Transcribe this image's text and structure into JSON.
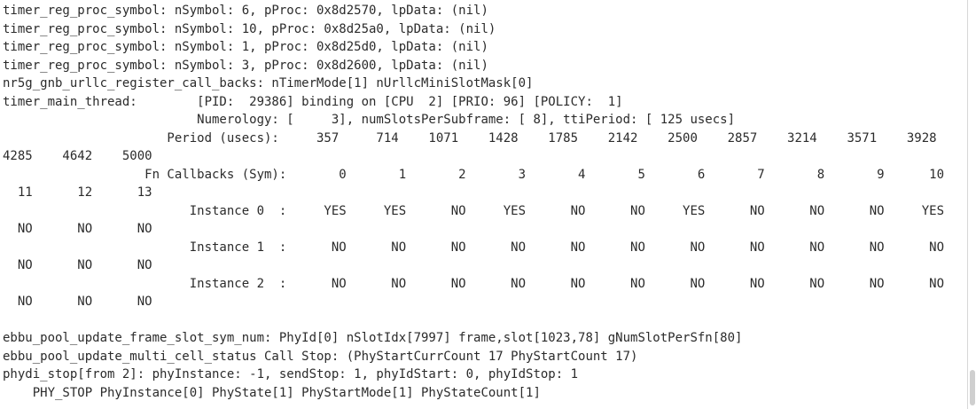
{
  "terminal": {
    "lines": [
      "timer_reg_proc_symbol: nSymbol: 6, pProc: 0x8d2570, lpData: (nil)",
      "timer_reg_proc_symbol: nSymbol: 10, pProc: 0x8d25a0, lpData: (nil)",
      "timer_reg_proc_symbol: nSymbol: 1, pProc: 0x8d25d0, lpData: (nil)",
      "timer_reg_proc_symbol: nSymbol: 3, pProc: 0x8d2600, lpData: (nil)",
      "nr5g_gnb_urllc_register_call_backs: nTimerMode[1] nUrllcMiniSlotMask[0]",
      "timer_main_thread:        [PID:  29386] binding on [CPU  2] [PRIO: 96] [POLICY:  1]",
      "                          Numerology: [     3], numSlotsPerSubframe: [ 8], ttiPeriod: [ 125 usecs]",
      "                      Period (usecs):     357     714    1071    1428    1785    2142    2500    2857    3214    3571    3928",
      "4285    4642    5000",
      "                   Fn Callbacks (Sym):       0       1       2       3       4       5       6       7       8       9      10",
      "  11      12      13",
      "                         Instance 0  :     YES     YES      NO     YES      NO      NO     YES      NO      NO      NO     YES",
      "  NO      NO      NO",
      "                         Instance 1  :      NO      NO      NO      NO      NO      NO      NO      NO      NO      NO      NO",
      "  NO      NO      NO",
      "                         Instance 2  :      NO      NO      NO      NO      NO      NO      NO      NO      NO      NO      NO",
      "  NO      NO      NO",
      "",
      "ebbu_pool_update_frame_slot_sym_num: PhyId[0] nSlotIdx[7997] frame,slot[1023,78] gNumSlotPerSfn[80]",
      "ebbu_pool_update_multi_cell_status Call Stop: (PhyStartCurrCount 17 PhyStartCount 17)",
      "phydi_stop[from 2]: phyInstance: -1, sendStop: 1, phyIdStart: 0, phyIdStop: 1",
      "    PHY_STOP PhyInstance[0] PhyState[1] PhyStartMode[1] PhyStateCount[1]"
    ]
  }
}
